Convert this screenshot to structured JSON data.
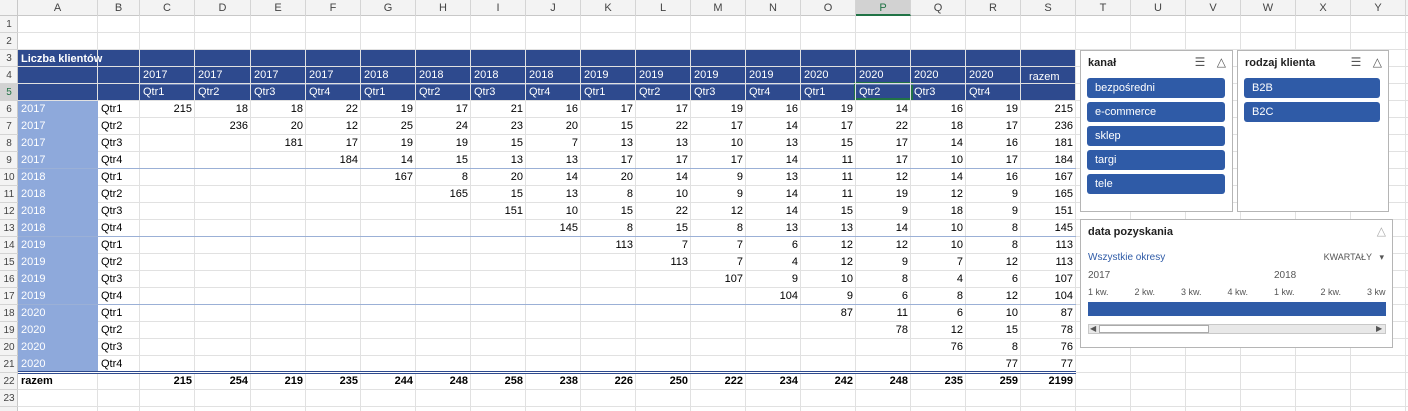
{
  "columns": [
    "A",
    "B",
    "C",
    "D",
    "E",
    "F",
    "G",
    "H",
    "I",
    "J",
    "K",
    "L",
    "M",
    "N",
    "O",
    "P",
    "Q",
    "R",
    "S",
    "T",
    "U",
    "V",
    "W",
    "X",
    "Y"
  ],
  "selected_column": "P",
  "rows": [
    "1",
    "2",
    "3",
    "4",
    "5",
    "6",
    "7",
    "8",
    "9",
    "10",
    "11",
    "12",
    "13",
    "14",
    "15",
    "16",
    "17",
    "18",
    "19",
    "20",
    "21",
    "22",
    "23"
  ],
  "selected_row": "5",
  "pivot": {
    "title": "Liczba klientów",
    "years": [
      "2017",
      "2017",
      "2017",
      "2017",
      "2018",
      "2018",
      "2018",
      "2018",
      "2019",
      "2019",
      "2019",
      "2019",
      "2020",
      "2020",
      "2020",
      "2020"
    ],
    "quarters": [
      "Qtr1",
      "Qtr2",
      "Qtr3",
      "Qtr4",
      "Qtr1",
      "Qtr2",
      "Qtr3",
      "Qtr4",
      "Qtr1",
      "Qtr2",
      "Qtr3",
      "Qtr4",
      "Qtr1",
      "Qtr2",
      "Qtr3",
      "Qtr4"
    ],
    "total_label": "razem",
    "row_years": [
      "2017",
      "2017",
      "2017",
      "2017",
      "2018",
      "2018",
      "2018",
      "2018",
      "2019",
      "2019",
      "2019",
      "2019",
      "2020",
      "2020",
      "2020",
      "2020"
    ],
    "row_quarters": [
      "Qtr1",
      "Qtr2",
      "Qtr3",
      "Qtr4",
      "Qtr1",
      "Qtr2",
      "Qtr3",
      "Qtr4",
      "Qtr1",
      "Qtr2",
      "Qtr3",
      "Qtr4",
      "Qtr1",
      "Qtr2",
      "Qtr3",
      "Qtr4"
    ],
    "values": [
      [
        "215",
        "18",
        "18",
        "22",
        "19",
        "17",
        "21",
        "16",
        "17",
        "17",
        "19",
        "16",
        "19",
        "14",
        "16",
        "19",
        "215"
      ],
      [
        "",
        "236",
        "20",
        "12",
        "25",
        "24",
        "23",
        "20",
        "15",
        "22",
        "17",
        "14",
        "17",
        "22",
        "18",
        "17",
        "236"
      ],
      [
        "",
        "",
        "181",
        "17",
        "19",
        "19",
        "15",
        "7",
        "13",
        "13",
        "10",
        "13",
        "15",
        "17",
        "14",
        "16",
        "181"
      ],
      [
        "",
        "",
        "",
        "184",
        "14",
        "15",
        "13",
        "13",
        "17",
        "17",
        "17",
        "14",
        "11",
        "17",
        "10",
        "17",
        "184"
      ],
      [
        "",
        "",
        "",
        "",
        "167",
        "8",
        "20",
        "14",
        "20",
        "14",
        "9",
        "13",
        "11",
        "12",
        "14",
        "16",
        "167"
      ],
      [
        "",
        "",
        "",
        "",
        "",
        "165",
        "15",
        "13",
        "8",
        "10",
        "9",
        "14",
        "11",
        "19",
        "12",
        "9",
        "165"
      ],
      [
        "",
        "",
        "",
        "",
        "",
        "",
        "151",
        "10",
        "15",
        "22",
        "12",
        "14",
        "15",
        "9",
        "18",
        "9",
        "151"
      ],
      [
        "",
        "",
        "",
        "",
        "",
        "",
        "",
        "145",
        "8",
        "15",
        "8",
        "13",
        "13",
        "14",
        "10",
        "8",
        "145"
      ],
      [
        "",
        "",
        "",
        "",
        "",
        "",
        "",
        "",
        "113",
        "7",
        "7",
        "6",
        "12",
        "12",
        "10",
        "8",
        "113"
      ],
      [
        "",
        "",
        "",
        "",
        "",
        "",
        "",
        "",
        "",
        "113",
        "7",
        "4",
        "12",
        "9",
        "7",
        "12",
        "113"
      ],
      [
        "",
        "",
        "",
        "",
        "",
        "",
        "",
        "",
        "",
        "",
        "107",
        "9",
        "10",
        "8",
        "4",
        "6",
        "107"
      ],
      [
        "",
        "",
        "",
        "",
        "",
        "",
        "",
        "",
        "",
        "",
        "",
        "104",
        "9",
        "6",
        "8",
        "12",
        "104"
      ],
      [
        "",
        "",
        "",
        "",
        "",
        "",
        "",
        "",
        "",
        "",
        "",
        "",
        "87",
        "11",
        "6",
        "10",
        "87"
      ],
      [
        "",
        "",
        "",
        "",
        "",
        "",
        "",
        "",
        "",
        "",
        "",
        "",
        "",
        "78",
        "12",
        "15",
        "78"
      ],
      [
        "",
        "",
        "",
        "",
        "",
        "",
        "",
        "",
        "",
        "",
        "",
        "",
        "",
        "",
        "76",
        "8",
        "76"
      ],
      [
        "",
        "",
        "",
        "",
        "",
        "",
        "",
        "",
        "",
        "",
        "",
        "",
        "",
        "",
        "",
        "77",
        "77"
      ]
    ],
    "totals_label": "razem",
    "totals": [
      "215",
      "254",
      "219",
      "235",
      "244",
      "248",
      "258",
      "238",
      "226",
      "250",
      "222",
      "234",
      "242",
      "248",
      "235",
      "259",
      "2199"
    ]
  },
  "slicer_kanal": {
    "title": "kanał",
    "items": [
      "bezpośredni",
      "e-commerce",
      "sklep",
      "targi",
      "tele"
    ]
  },
  "slicer_rodzaj": {
    "title": "rodzaj klienta",
    "items": [
      "B2B",
      "B2C"
    ]
  },
  "timeline": {
    "title": "data pozyskania",
    "all_periods": "Wszystkie okresy",
    "level": "KWARTAŁY",
    "years": [
      "2017",
      "2018"
    ],
    "quarters": [
      "1 kw.",
      "2 kw.",
      "3 kw.",
      "4 kw.",
      "1 kw.",
      "2 kw.",
      "3 kw"
    ]
  },
  "icons": {
    "multiselect": "multiselect-icon",
    "clear_filter": "clear-filter-icon"
  },
  "colors": {
    "header_blue": "#2e4a8e",
    "row_label_blue": "#8ea9db",
    "slicer_button": "#2f5ba7",
    "excel_green": "#217346"
  }
}
